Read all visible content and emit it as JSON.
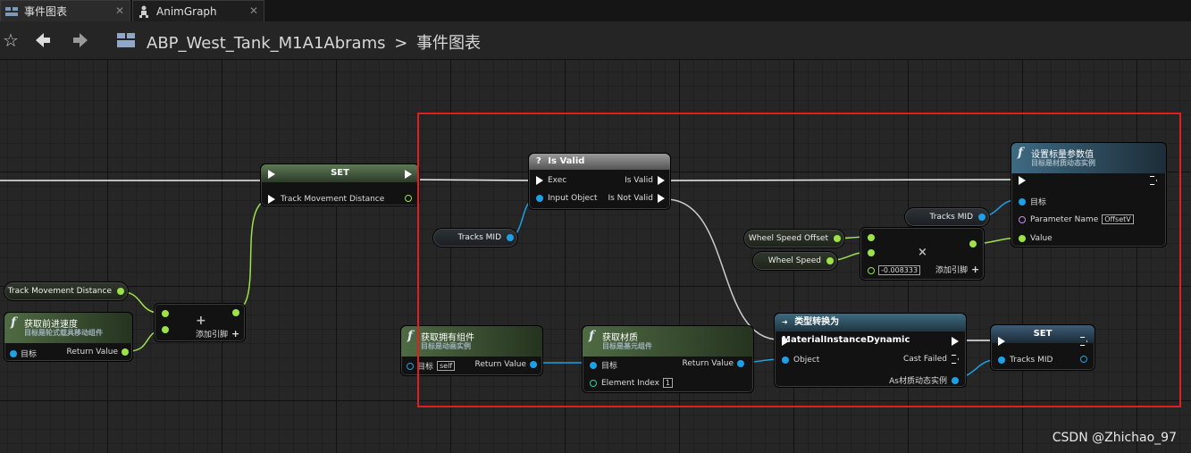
{
  "tabs": [
    {
      "label": "事件图表",
      "icon": "event-graph-icon"
    },
    {
      "label": "AnimGraph",
      "icon": "anim-graph-icon"
    }
  ],
  "toolbar": {
    "favorite_icon": "star-icon",
    "back_icon": "arrow-left-icon",
    "forward_icon": "arrow-right-icon",
    "graph_icon": "graph-icon",
    "breadcrumb_asset": "ABP_West_Tank_M1A1Abrams",
    "breadcrumb_sep": ">",
    "breadcrumb_graph": "事件图表"
  },
  "nodes": {
    "set1": {
      "title": "SET",
      "pin": "Track Movement Distance"
    },
    "get_track_dist": {
      "label": "Track Movement Distance"
    },
    "get_forward_speed": {
      "title": "获取前进速度",
      "subtitle": "目标是轮式载具移动组件",
      "target": "目标",
      "return": "Return Value"
    },
    "add_node": {
      "symbol": "+",
      "add_pin": "添加引脚"
    },
    "is_valid": {
      "title": "Is Valid",
      "exec": "Exec",
      "input": "Input Object",
      "out_valid": "Is Valid",
      "out_not_valid": "Is Not Valid"
    },
    "tracks_mid_var1": {
      "label": "Tracks MID"
    },
    "tracks_mid_var2": {
      "label": "Tracks MID"
    },
    "wheel_speed_offset": {
      "label": "Wheel Speed Offset"
    },
    "wheel_speed": {
      "label": "Wheel Speed"
    },
    "multiply": {
      "symbol": "×",
      "constant": "-0.008333",
      "add_pin": "添加引脚"
    },
    "set_scalar": {
      "title": "设置标量参数值",
      "subtitle": "目标是材质动态实例",
      "target": "目标",
      "param_name": "Parameter Name",
      "param_value": "OffsetV",
      "value": "Value"
    },
    "get_owner": {
      "title": "获取拥有组件",
      "subtitle": "目标是动画实例",
      "target": "目标",
      "self": "self",
      "return": "Return Value"
    },
    "get_material": {
      "title": "获取材质",
      "subtitle": "目标是基元组件",
      "target": "目标",
      "return": "Return Value",
      "elem_index": "Element Index",
      "elem_value": "1"
    },
    "cast": {
      "title": "类型转换为 MaterialInstanceDynamic",
      "object": "Object",
      "cast_failed": "Cast Failed",
      "as_mid": "As材质动态实例"
    },
    "set2": {
      "title": "SET",
      "pin": "Tracks MID"
    }
  },
  "colors": {
    "float_pin": "#9ee24a",
    "object_pin": "#1da0e6",
    "name_pin": "#c18ee6",
    "int_pin": "#2ed39d",
    "selection": "#e02020"
  },
  "watermark": "CSDN @Zhichao_97"
}
